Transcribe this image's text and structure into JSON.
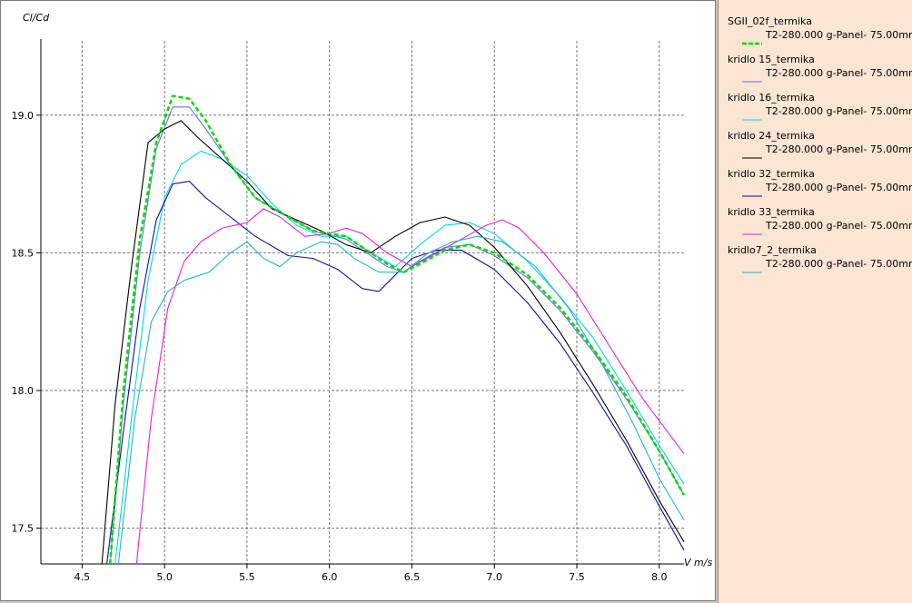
{
  "chart_data": {
    "type": "line",
    "ylabel": "Cl/Cd",
    "xlabel": "V m/s",
    "xlim": [
      4.25,
      8.15
    ],
    "ylim": [
      17.37,
      19.27
    ],
    "xticks": [
      "4.5",
      "5.0",
      "5.5",
      "6.0",
      "6.5",
      "7.0",
      "7.5",
      "8.0"
    ],
    "xtick_values": [
      4.5,
      5.0,
      5.5,
      6.0,
      6.5,
      7.0,
      7.5,
      8.0
    ],
    "yticks": [
      "17.5",
      "18.0",
      "18.5",
      "19.0"
    ],
    "ytick_values": [
      17.5,
      18.0,
      18.5,
      19.0
    ],
    "grid": true,
    "legend_position": "right",
    "series": [
      {
        "name": "SGII_02f_termika",
        "sub": "T2-280.000 g-Panel- 75.00mm",
        "color": "#00dd00",
        "dashed": true,
        "x": [
          4.67,
          4.75,
          4.85,
          4.95,
          5.05,
          5.15,
          5.25,
          5.4,
          5.55,
          5.75,
          5.9,
          6.1,
          6.25,
          6.35,
          6.45,
          6.55,
          6.7,
          6.85,
          7.0,
          7.2,
          7.4,
          7.6,
          7.8,
          8.0,
          8.15
        ],
        "y": [
          17.37,
          18.0,
          18.55,
          18.9,
          19.07,
          19.06,
          18.98,
          18.82,
          18.7,
          18.63,
          18.58,
          18.56,
          18.5,
          18.46,
          18.43,
          18.46,
          18.51,
          18.53,
          18.5,
          18.42,
          18.3,
          18.15,
          17.98,
          17.78,
          17.62
        ]
      },
      {
        "name": "kridlo 15_termika",
        "sub": "T2-280.000 g-Panel- 75.00mm",
        "color": "#7070e0",
        "dashed": false,
        "x": [
          4.67,
          4.75,
          4.85,
          4.95,
          5.05,
          5.15,
          5.25,
          5.4,
          5.55,
          5.75,
          5.9,
          6.1,
          6.25,
          6.35,
          6.45,
          6.55,
          6.7,
          6.85,
          7.0,
          7.2,
          7.4,
          7.6,
          7.8,
          8.0,
          8.15
        ],
        "y": [
          17.37,
          17.95,
          18.5,
          18.88,
          19.03,
          19.03,
          18.95,
          18.82,
          18.7,
          18.63,
          18.58,
          18.55,
          18.49,
          18.45,
          18.43,
          18.47,
          18.52,
          18.53,
          18.49,
          18.41,
          18.29,
          18.14,
          17.97,
          17.78,
          17.62
        ]
      },
      {
        "name": "kridlo 16_termika",
        "sub": "T2-280.000 g-Panel- 75.00mm",
        "color": "#00d8f0",
        "dashed": false,
        "x": [
          4.7,
          4.8,
          4.9,
          5.0,
          5.1,
          5.22,
          5.35,
          5.5,
          5.65,
          5.8,
          5.95,
          6.1,
          6.25,
          6.4,
          6.55,
          6.7,
          6.85,
          7.0,
          7.2,
          7.4,
          7.6,
          7.8,
          8.0,
          8.15
        ],
        "y": [
          17.37,
          17.9,
          18.4,
          18.7,
          18.82,
          18.87,
          18.84,
          18.78,
          18.68,
          18.6,
          18.56,
          18.56,
          18.5,
          18.45,
          18.53,
          18.6,
          18.61,
          18.57,
          18.47,
          18.34,
          18.19,
          18.0,
          17.8,
          17.66
        ]
      },
      {
        "name": "kridlo 24_termika",
        "sub": "T2-280.000 g-Panel- 75.00mm",
        "color": "#000000",
        "dashed": false,
        "x": [
          4.62,
          4.7,
          4.8,
          4.9,
          5.0,
          5.1,
          5.2,
          5.35,
          5.5,
          5.65,
          5.8,
          5.95,
          6.1,
          6.25,
          6.4,
          6.55,
          6.7,
          6.85,
          7.0,
          7.2,
          7.4,
          7.6,
          7.8,
          8.0,
          8.15
        ],
        "y": [
          17.37,
          17.95,
          18.45,
          18.9,
          18.95,
          18.98,
          18.92,
          18.84,
          18.76,
          18.66,
          18.62,
          18.58,
          18.53,
          18.5,
          18.56,
          18.61,
          18.63,
          18.6,
          18.52,
          18.38,
          18.21,
          18.02,
          17.82,
          17.6,
          17.45
        ]
      },
      {
        "name": "kridlo 32_termika",
        "sub": "T2-280.000 g-Panel- 75.00mm",
        "color": "#1010a0",
        "dashed": false,
        "x": [
          4.65,
          4.75,
          4.85,
          4.95,
          5.05,
          5.15,
          5.25,
          5.4,
          5.55,
          5.75,
          5.9,
          6.05,
          6.2,
          6.3,
          6.4,
          6.5,
          6.65,
          6.8,
          7.0,
          7.2,
          7.4,
          7.6,
          7.8,
          8.0,
          8.15
        ],
        "y": [
          17.37,
          17.85,
          18.3,
          18.62,
          18.75,
          18.76,
          18.7,
          18.63,
          18.56,
          18.49,
          18.48,
          18.44,
          18.37,
          18.36,
          18.42,
          18.48,
          18.51,
          18.51,
          18.44,
          18.32,
          18.17,
          17.99,
          17.8,
          17.58,
          17.42
        ]
      },
      {
        "name": "kridlo 33_termika",
        "sub": "T2-280.000 g-Panel- 75.00mm",
        "color": "#e020e0",
        "dashed": false,
        "x": [
          4.83,
          4.92,
          5.02,
          5.12,
          5.22,
          5.35,
          5.5,
          5.6,
          5.7,
          5.85,
          6.0,
          6.1,
          6.2,
          6.35,
          6.5,
          6.65,
          6.8,
          6.95,
          7.05,
          7.15,
          7.3,
          7.5,
          7.7,
          7.9,
          8.15
        ],
        "y": [
          17.37,
          17.9,
          18.3,
          18.47,
          18.54,
          18.59,
          18.61,
          18.66,
          18.63,
          18.56,
          18.57,
          18.59,
          18.57,
          18.5,
          18.45,
          18.5,
          18.55,
          18.6,
          18.62,
          18.59,
          18.5,
          18.35,
          18.16,
          17.97,
          17.77
        ]
      },
      {
        "name": "kridlo7_2_termika",
        "sub": "T2-280.000 g-Panel- 75.00mm",
        "color": "#20b8c8",
        "dashed": false,
        "x": [
          4.72,
          4.82,
          4.92,
          5.02,
          5.12,
          5.27,
          5.4,
          5.5,
          5.6,
          5.7,
          5.8,
          5.95,
          6.05,
          6.15,
          6.3,
          6.45,
          6.6,
          6.75,
          6.9,
          7.05,
          7.25,
          7.45,
          7.65,
          7.85,
          8.0,
          8.15
        ],
        "y": [
          17.37,
          17.9,
          18.25,
          18.36,
          18.4,
          18.43,
          18.5,
          18.54,
          18.48,
          18.45,
          18.5,
          18.54,
          18.53,
          18.48,
          18.43,
          18.43,
          18.5,
          18.54,
          18.56,
          18.54,
          18.45,
          18.3,
          18.1,
          17.87,
          17.68,
          17.53
        ]
      }
    ]
  }
}
